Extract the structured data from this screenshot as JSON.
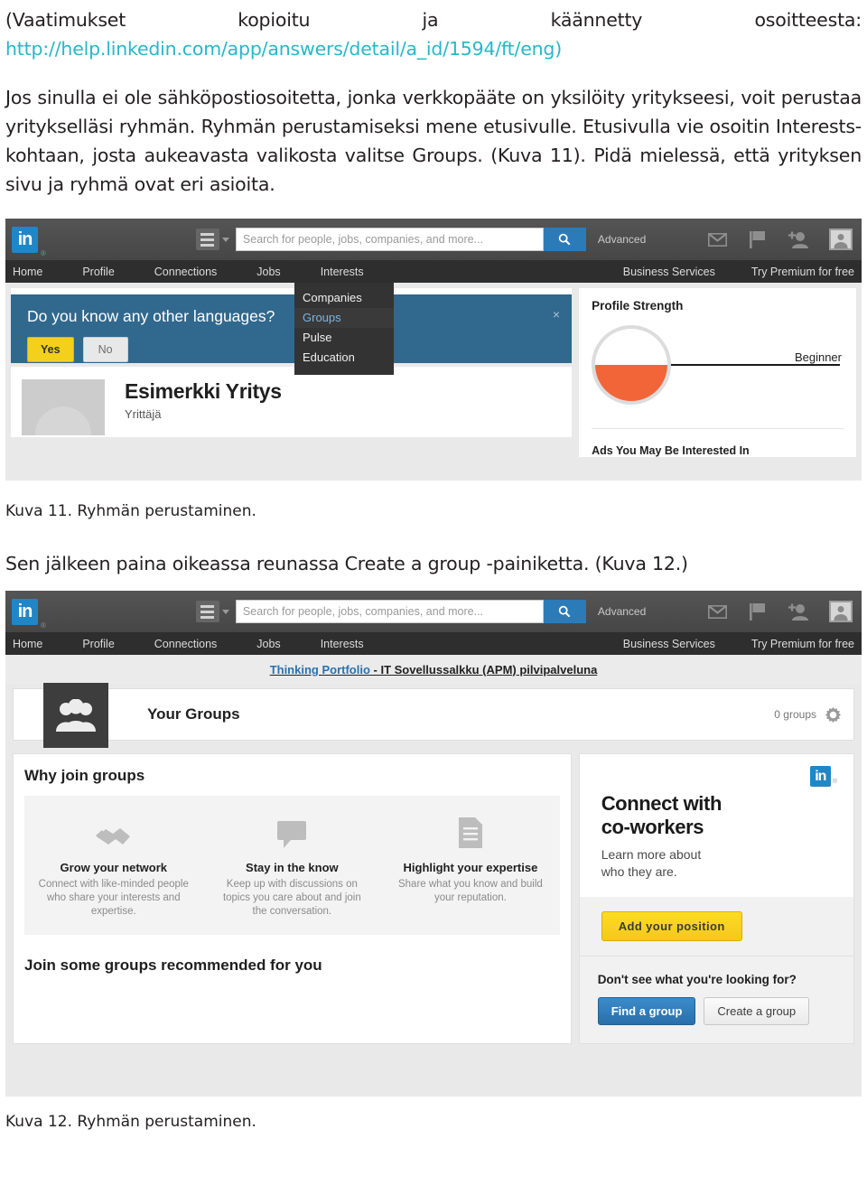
{
  "document": {
    "paragraph1_pre": "(Vaatimukset kopioitu ja käännetty osoitteesta: ",
    "paragraph1_link": "http://help.linkedin.com/app/answers/detail/a_id/1594/ft/eng)",
    "paragraph2": "Jos sinulla ei ole sähköpostiosoitetta, jonka verkkopääte on yksilöity yritykseesi, voit perustaa yritykselläsi ryhmän. Ryhmän perustamiseksi mene etusivulle. Etusivulla vie osoitin Interests-kohtaan, josta aukeavasta valikosta valitse Groups. (Kuva 11). Pidä mielessä, että yrityksen sivu ja ryhmä ovat eri asioita.",
    "caption11": "Kuva 11. Ryhmän perustaminen.",
    "paragraph3": "Sen jälkeen paina oikeassa reunassa Create a group -painiketta. (Kuva 12.)",
    "caption12": "Kuva 12. Ryhmän perustaminen.",
    "link_color": "#27b7c8"
  },
  "shot1": {
    "logo": "in",
    "logo_r": "®",
    "search_placeholder": "Search for people, jobs, companies, and more...",
    "advanced": "Advanced",
    "nav": [
      "Home",
      "Profile",
      "Connections",
      "Jobs",
      "Interests"
    ],
    "nav_right": [
      "Business Services",
      "Try Premium for free"
    ],
    "dropdown": {
      "items": [
        "Companies",
        "Groups",
        "Pulse",
        "Education"
      ],
      "selected": "Groups",
      "selected_color": "#7fb4de"
    },
    "language_card": {
      "question": "Do you know any other languages?",
      "yes": "Yes",
      "no": "No",
      "close": "×",
      "banner_color": "#31688e",
      "yes_color": "#f3d01c"
    },
    "profile": {
      "name": "Esimerkki Yritys",
      "title": "Yrittäjä"
    },
    "sidebar": {
      "strength_title": "Profile Strength",
      "strength_level": "Beginner",
      "strength_fill_color": "#f26538",
      "strength_percent": 50,
      "ads_title": "Ads You May Be Interested In"
    }
  },
  "shot2": {
    "logo": "in",
    "logo_r": "®",
    "search_placeholder": "Search for people, jobs, companies, and more...",
    "advanced": "Advanced",
    "nav": [
      "Home",
      "Profile",
      "Connections",
      "Jobs",
      "Interests"
    ],
    "nav_right": [
      "Business Services",
      "Try Premium for free"
    ],
    "ad_banner_bold": "Thinking Portfolio",
    "ad_banner_rest": " - IT Sovellussalkku (APM) pilvipalveluna",
    "groups_header": {
      "title": "Your Groups",
      "count": "0 groups"
    },
    "why": {
      "title": "Why join groups",
      "items": [
        {
          "icon": "handshake-icon",
          "heading": "Grow your network",
          "text": "Connect with like-minded people who share your interests and expertise."
        },
        {
          "icon": "speech-bubble-icon",
          "heading": "Stay in the know",
          "text": "Keep up with discussions on topics you care about and join the conversation."
        },
        {
          "icon": "checklist-icon",
          "heading": "Highlight your expertise",
          "text": "Share what you know and build your reputation."
        }
      ]
    },
    "join_title": "Join some groups recommended for you",
    "ad_card": {
      "heading_line1": "Connect with",
      "heading_line2": "co-workers",
      "text_line1": "Learn more about",
      "text_line2": "who they are.",
      "button": "Add your position",
      "button_color": "#f5c81b"
    },
    "find_card": {
      "question": "Don't see what you're looking for?",
      "find_button": "Find a group",
      "create_button": "Create a group",
      "find_color": "#2a6fab"
    }
  }
}
